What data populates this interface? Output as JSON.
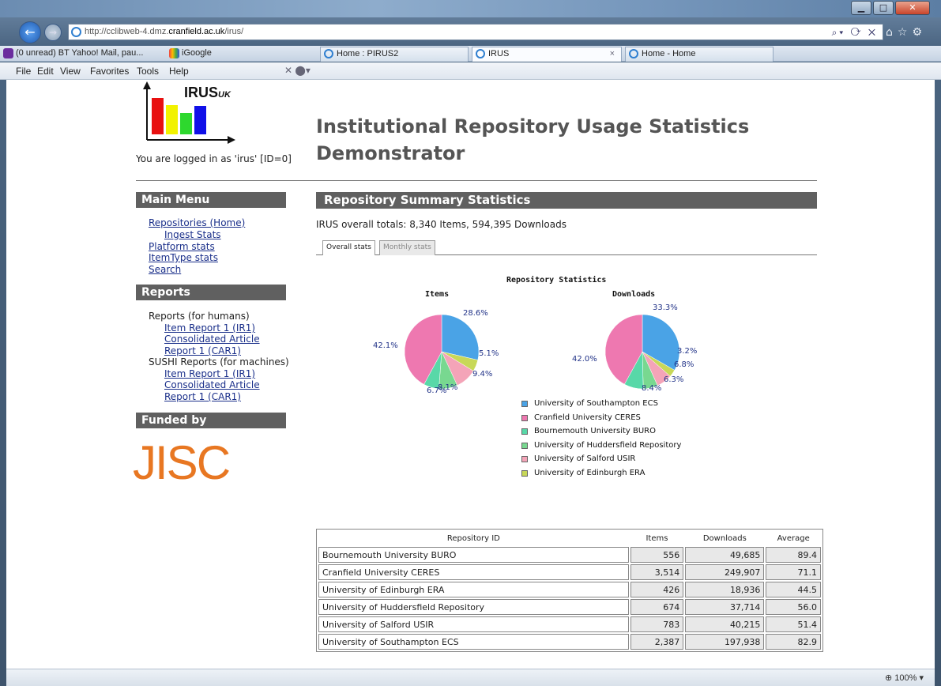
{
  "browser": {
    "url_prefix": "http://cclibweb-4.dmz.",
    "url_host": "cranfield.ac.uk",
    "url_suffix": "/irus/",
    "favorites": [
      {
        "label": "(0 unread) BT Yahoo! Mail, pau..."
      },
      {
        "label": "iGoogle"
      }
    ],
    "tabs": [
      {
        "label": "Home : PIRUS2"
      },
      {
        "label": "IRUS"
      },
      {
        "label": "Home - Home"
      }
    ],
    "menu": [
      "File",
      "Edit",
      "View",
      "Favorites",
      "Tools",
      "Help"
    ],
    "zoom": "100%"
  },
  "header": {
    "logo_text": "IRUS",
    "logo_sub": "UK",
    "logged_in": "You are logged in as 'irus' [ID=0]",
    "title": "Institutional Repository Usage Statistics Demonstrator"
  },
  "sidebar": {
    "main_menu_title": "Main Menu",
    "main_menu": [
      {
        "label": "Repositories (Home)"
      },
      {
        "label": "Ingest Stats"
      },
      {
        "label": "Platform stats"
      },
      {
        "label": "ItemType stats"
      },
      {
        "label": "Search"
      }
    ],
    "reports_title": "Reports",
    "reports_humans": "Reports (for humans)",
    "reports_humans_links": [
      "Item Report 1 (IR1)",
      "Consolidated Article",
      "Report 1 (CAR1)"
    ],
    "reports_sushi": "SUSHI Reports (for machines)",
    "reports_sushi_links": [
      "Item Report 1 (IR1)",
      "Consolidated Article",
      "Report 1 (CAR1)"
    ],
    "funded_title": "Funded by",
    "funder": "JISC"
  },
  "main": {
    "heading": "Repository Summary Statistics",
    "totals": "IRUS overall totals: 8,340 Items, 594,395 Downloads",
    "tabs": [
      {
        "label": "Overall stats"
      },
      {
        "label": "Monthly stats"
      }
    ]
  },
  "chart_data": [
    {
      "type": "pie",
      "title": "Repository Statistics",
      "subtitle": "Items",
      "labels": [
        "University of Southampton ECS",
        "University of Edinburgh ERA",
        "University of Salford USIR",
        "University of Huddersfield Repository",
        "Bournemouth University BURO",
        "Cranfield University CERES"
      ],
      "values": [
        28.6,
        5.1,
        9.4,
        8.1,
        6.7,
        42.1
      ],
      "value_labels": [
        "28.6%",
        "5.1%",
        "9.4%",
        "8.1%",
        "6.7%",
        "42.1%"
      ],
      "colors": [
        "#4aa3e6",
        "#c8d858",
        "#f4a4b8",
        "#78d890",
        "#58d8a8",
        "#ee78b0"
      ]
    },
    {
      "type": "pie",
      "subtitle": "Downloads",
      "labels": [
        "University of Southampton ECS",
        "University of Edinburgh ERA",
        "University of Salford USIR",
        "University of Huddersfield Repository",
        "Bournemouth University BURO",
        "Cranfield University CERES"
      ],
      "values": [
        33.3,
        3.2,
        6.8,
        6.3,
        8.4,
        42.0
      ],
      "value_labels": [
        "33.3%",
        "3.2%",
        "6.8%",
        "6.3%",
        "8.4%",
        "42.0%"
      ],
      "colors": [
        "#4aa3e6",
        "#c8d858",
        "#f4a4b8",
        "#78d890",
        "#58d8a8",
        "#ee78b0"
      ]
    }
  ],
  "legend": [
    {
      "label": "University of Southampton ECS",
      "color": "#4aa3e6"
    },
    {
      "label": "Cranfield University CERES",
      "color": "#ee78b0"
    },
    {
      "label": "Bournemouth University BURO",
      "color": "#58d8a8"
    },
    {
      "label": "University of Huddersfield Repository",
      "color": "#78d890"
    },
    {
      "label": "University of Salford USIR",
      "color": "#f4a4b8"
    },
    {
      "label": "University of Edinburgh ERA",
      "color": "#c8d858"
    }
  ],
  "table": {
    "columns": [
      "Repository ID",
      "Items",
      "Downloads",
      "Average"
    ],
    "rows": [
      [
        "Bournemouth University BURO",
        "556",
        "49,685",
        "89.4"
      ],
      [
        "Cranfield University CERES",
        "3,514",
        "249,907",
        "71.1"
      ],
      [
        "University of Edinburgh ERA",
        "426",
        "18,936",
        "44.5"
      ],
      [
        "University of Huddersfield Repository",
        "674",
        "37,714",
        "56.0"
      ],
      [
        "University of Salford USIR",
        "783",
        "40,215",
        "51.4"
      ],
      [
        "University of Southampton ECS",
        "2,387",
        "197,938",
        "82.9"
      ]
    ]
  }
}
